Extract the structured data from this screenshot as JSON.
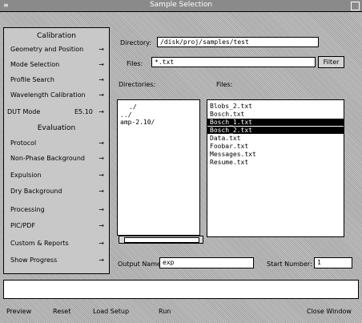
{
  "window": {
    "title": "Sample Selection",
    "menu_glyph": "≡"
  },
  "sidebar": {
    "calibration_header": "Calibration",
    "calibration_items": [
      {
        "label": "Geometry and Position",
        "arrow": "→"
      },
      {
        "label": "Mode Selection",
        "arrow": "→"
      },
      {
        "label": "Profile Search",
        "arrow": "→"
      },
      {
        "label": "Wavelength Calibration",
        "arrow": "→"
      }
    ],
    "dut_mode_label": "DUT Mode",
    "dut_mode_value": "E5.10",
    "evaluation_header": "Evaluation",
    "evaluation_items": [
      {
        "label": "Protocol",
        "arrow": "→"
      },
      {
        "label": "Non-Phase Background",
        "arrow": "→"
      },
      {
        "label": "Expulsion",
        "arrow": "→"
      },
      {
        "label": "Dry Background",
        "arrow": "→"
      },
      {
        "label": "Processing",
        "arrow": "→"
      },
      {
        "label": "PIC/PDF",
        "arrow": "→"
      },
      {
        "label": "Custom & Reports",
        "arrow": "→"
      },
      {
        "label": "Show Progress",
        "arrow": "→"
      }
    ]
  },
  "main": {
    "directory_label": "Directory:",
    "directory_value": "/disk/proj/samples/test",
    "files_filter_label": "Files:",
    "files_filter_value": "*.txt",
    "filter_button": "Filter",
    "directories_header": "Directories:",
    "files_header": "Files:",
    "directories": [
      "./",
      "../",
      "amp-2.10/"
    ],
    "files": [
      {
        "name": "Blobs_2.txt",
        "selected": false
      },
      {
        "name": "Bosch.txt",
        "selected": false
      },
      {
        "name": "Bosch_1.txt",
        "selected": true
      },
      {
        "name": "Bosch_2.txt",
        "selected": true
      },
      {
        "name": "Data.txt",
        "selected": false
      },
      {
        "name": "Foobar.txt",
        "selected": false
      },
      {
        "name": "Messages.txt",
        "selected": false
      },
      {
        "name": "Resume.txt",
        "selected": false
      }
    ],
    "output_name_label": "Output Name:",
    "output_name_value": "exp",
    "start_number_label": "Start Number:",
    "start_number_value": "1"
  },
  "status": {
    "message": ""
  },
  "buttons": {
    "preview": "Preview",
    "reset": "Reset",
    "load_setup": "Load Setup",
    "run": "Run",
    "close_window": "Close Window"
  }
}
